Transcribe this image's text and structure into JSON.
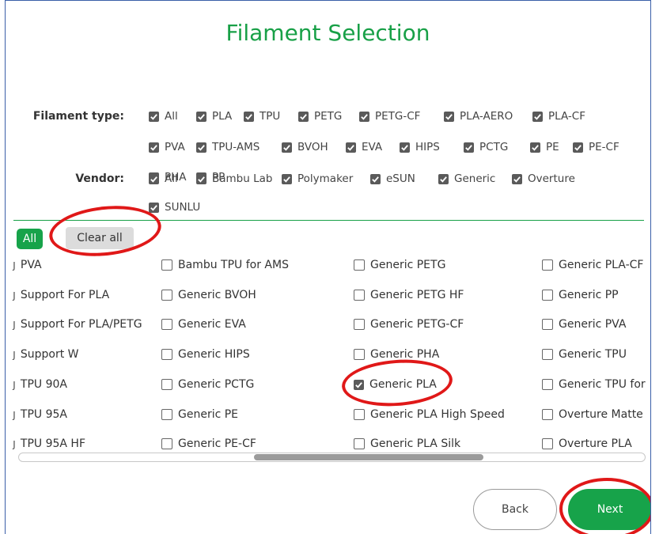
{
  "title": "Filament Selection",
  "filament_type": {
    "label": "Filament type:",
    "options": [
      "All",
      "PLA",
      "TPU",
      "PETG",
      "PETG-CF",
      "PLA-AERO",
      "PLA-CF",
      "PVA",
      "TPU-AMS",
      "BVOH",
      "EVA",
      "HIPS",
      "PCTG",
      "PE",
      "PE-CF",
      "PHA",
      "PP"
    ]
  },
  "vendor": {
    "label": "Vendor:",
    "options": [
      "All",
      "Bambu Lab",
      "Polymaker",
      "eSUN",
      "Generic",
      "Overture",
      "SUNLU"
    ]
  },
  "list_buttons": {
    "all": "All",
    "clear_all": "Clear all"
  },
  "filament_list": {
    "columns": [
      [
        {
          "label": "PVA",
          "checked": null
        },
        {
          "label": "Support For PLA",
          "checked": null
        },
        {
          "label": "Support For PLA/PETG",
          "checked": null
        },
        {
          "label": "Support W",
          "checked": null
        },
        {
          "label": "TPU 90A",
          "checked": null
        },
        {
          "label": "TPU 95A",
          "checked": null
        },
        {
          "label": "TPU 95A HF",
          "checked": null
        }
      ],
      [
        {
          "label": "Bambu TPU for AMS",
          "checked": false
        },
        {
          "label": "Generic BVOH",
          "checked": false
        },
        {
          "label": "Generic EVA",
          "checked": false
        },
        {
          "label": "Generic HIPS",
          "checked": false
        },
        {
          "label": "Generic PCTG",
          "checked": false
        },
        {
          "label": "Generic PE",
          "checked": false
        },
        {
          "label": "Generic PE-CF",
          "checked": false
        }
      ],
      [
        {
          "label": "Generic PETG",
          "checked": false
        },
        {
          "label": "Generic PETG HF",
          "checked": false
        },
        {
          "label": "Generic PETG-CF",
          "checked": false
        },
        {
          "label": "Generic PHA",
          "checked": false
        },
        {
          "label": "Generic PLA",
          "checked": true
        },
        {
          "label": "Generic PLA High Speed",
          "checked": false
        },
        {
          "label": "Generic PLA Silk",
          "checked": false
        }
      ],
      [
        {
          "label": "Generic PLA-CF",
          "checked": false
        },
        {
          "label": "Generic PP",
          "checked": false
        },
        {
          "label": "Generic PVA",
          "checked": false
        },
        {
          "label": "Generic TPU",
          "checked": false
        },
        {
          "label": "Generic TPU for",
          "checked": false
        },
        {
          "label": "Overture Matte",
          "checked": false
        },
        {
          "label": "Overture PLA",
          "checked": false
        }
      ]
    ],
    "truncated_prefix": "ȷ"
  },
  "navigation": {
    "back": "Back",
    "next": "Next"
  },
  "colors": {
    "accent": "#17a34a",
    "annotation": "#e01818",
    "frame_border": "#3a5fa8"
  }
}
